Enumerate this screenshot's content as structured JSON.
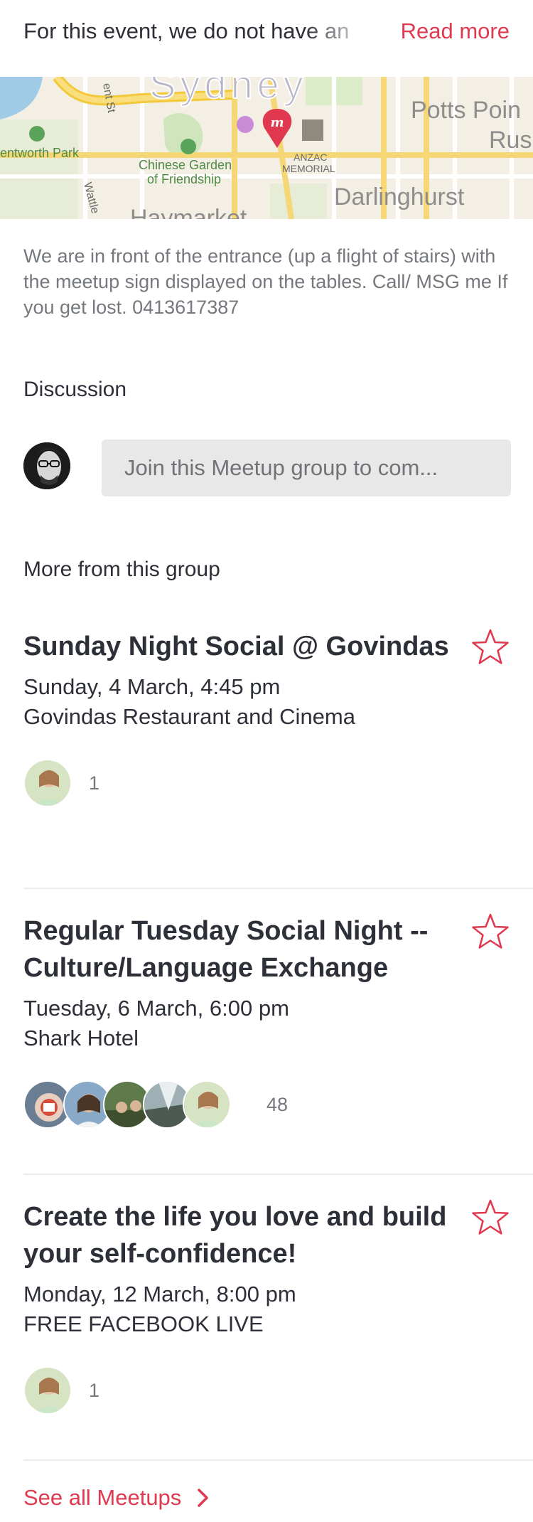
{
  "top": {
    "description": "For this event, we do not have an",
    "read_more": "Read more"
  },
  "map": {
    "labels": {
      "city": "Sydney",
      "potts_point": "Potts Poin",
      "rus": "Rus",
      "wentworth_park": "entworth Park",
      "chinese_garden_1": "Chinese Garden",
      "chinese_garden_2": "of Friendship",
      "anzac_1": "ANZAC",
      "anzac_2": "MEMORIAL",
      "darlinghurst": "Darlinghurst",
      "haymarket": "Haymarket",
      "wattle": "Wattle",
      "kent_st": "ent St"
    }
  },
  "location_note": "We are in front of the entrance (up a flight of stairs) with the meetup sign displayed on the tables. Call/ MSG me If you get lost. 0413617387",
  "discussion": {
    "title": "Discussion",
    "placeholder": "Join this Meetup group to com..."
  },
  "more": {
    "title": "More from this group",
    "events": [
      {
        "title": "Sunday Night Social @ Govindas",
        "date": "Sunday, 4 March, 4:45 pm",
        "venue": "Govindas Restaurant and Cinema",
        "count": "1"
      },
      {
        "title": "Regular Tuesday Social Night -- Culture/Language Exchange",
        "date": "Tuesday, 6 March, 6:00 pm",
        "venue": "Shark Hotel",
        "count": "48"
      },
      {
        "title": "Create the life you love and build your self-confidence!",
        "date": "Monday, 12 March, 8:00 pm",
        "venue": "FREE FACEBOOK LIVE",
        "count": "1"
      }
    ],
    "see_all": "See all Meetups"
  },
  "colors": {
    "accent": "#e0394f",
    "text": "#2e3039",
    "muted": "#75787d"
  }
}
